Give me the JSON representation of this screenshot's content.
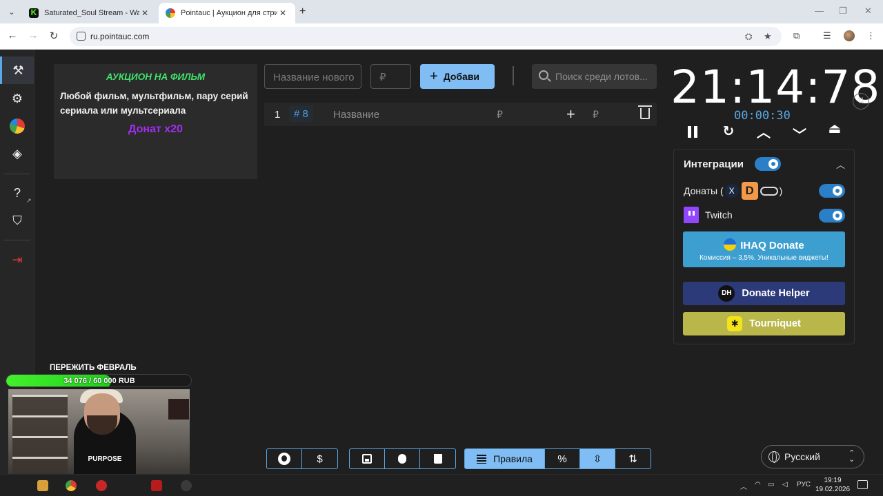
{
  "browser": {
    "tabs": [
      {
        "title": "Saturated_Soul Stream - Watch",
        "active": false
      },
      {
        "title": "Pointauc | Аукцион для стриме",
        "active": true
      }
    ],
    "url": "ru.pointauc.com"
  },
  "sidebar": {
    "items": [
      "auction-gavel-icon",
      "gear-icon",
      "wheel-pie-icon",
      "layers-icon",
      "help-icon",
      "shield-icon",
      "logout-icon"
    ]
  },
  "rules_card": {
    "title": "АУКЦИОН НА ФИЛЬМ",
    "body": "Любой фильм, мультфильм, пару серий сериала или мультсериала",
    "donation_note": "Донат x20"
  },
  "add_lot": {
    "name_placeholder": "Название нового",
    "cost_placeholder": "₽",
    "add_label": "Добавить"
  },
  "search": {
    "placeholder": "Поиск среди лотов..."
  },
  "lots": [
    {
      "index": "1",
      "id": "# 8",
      "name_placeholder": "Название",
      "amount_placeholder": "₽",
      "add_amount_placeholder": "₽"
    }
  ],
  "timer": {
    "main": "21:14:78",
    "step": "00:00:30"
  },
  "integrations": {
    "title": "Интеграции",
    "enabled": true,
    "donations_label_open": "Донаты (",
    "donations_label_close": ")",
    "donations_enabled": true,
    "twitch_label": "Twitch",
    "twitch_enabled": true,
    "ihaq": {
      "title": "IHAQ Donate",
      "subtitle": "Комиссия – 3,5%. Уникальные виджеты!"
    },
    "donate_helper": {
      "icon_text": "DH",
      "label": "Donate Helper"
    },
    "tourniquet": {
      "label": "Tourniquet"
    }
  },
  "bottom_toolbar": {
    "rules_label": "Правила",
    "percent_label": "%",
    "currency_label": "$"
  },
  "language": {
    "selected": "Русский"
  },
  "stream_overlay": {
    "goal_title": "ПЕРЕЖИТЬ ФЕВРАЛЬ",
    "goal_progress_text": "34 076 / 60 000 RUB",
    "goal_progress_fraction": 0.568,
    "shirt_text": "PURPOSE"
  },
  "taskbar": {
    "lang": "РУС",
    "time": "19:19",
    "date": "19.02.2026"
  },
  "colors": {
    "accent": "#7fbdf4",
    "timer_step": "#5aa9e6",
    "rules_title": "#3fe36b",
    "donation_note": "#a32ef0",
    "ihaq_button": "#3d9fd0",
    "donate_helper_button": "#2c3a7a",
    "tourniquet_button": "#b9b74a"
  }
}
